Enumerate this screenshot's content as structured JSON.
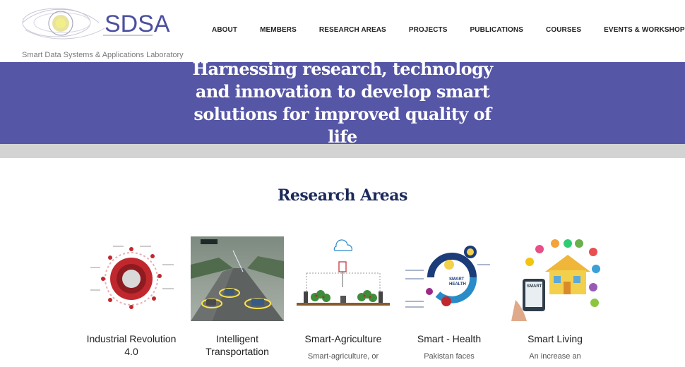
{
  "header": {
    "logo_text": "SDSA",
    "tagline": "Smart Data Systems & Applications Laboratory"
  },
  "nav": [
    {
      "label": "ABOUT"
    },
    {
      "label": "MEMBERS"
    },
    {
      "label": "RESEARCH AREAS"
    },
    {
      "label": "PROJECTS"
    },
    {
      "label": "PUBLICATIONS"
    },
    {
      "label": "COURSES"
    },
    {
      "label": "EVENTS & WORKSHOPS"
    }
  ],
  "hero": {
    "headline": "Harnessing research, technology and innovation to develop smart solutions for improved quality of life"
  },
  "research": {
    "title": "Research Areas",
    "cards": [
      {
        "title": "Industrial Revolution 4.0",
        "desc": ""
      },
      {
        "title": "Intelligent Transportation",
        "desc": ""
      },
      {
        "title": "Smart-Agriculture",
        "desc": "Smart-agriculture, or"
      },
      {
        "title": "Smart - Health",
        "desc": "Pakistan faces"
      },
      {
        "title": "Smart Living",
        "desc": "An increase an"
      }
    ]
  },
  "colors": {
    "hero_bg": "#5656a6",
    "title_color": "#1c2a5a",
    "logo_color": "#4a4fa0"
  }
}
